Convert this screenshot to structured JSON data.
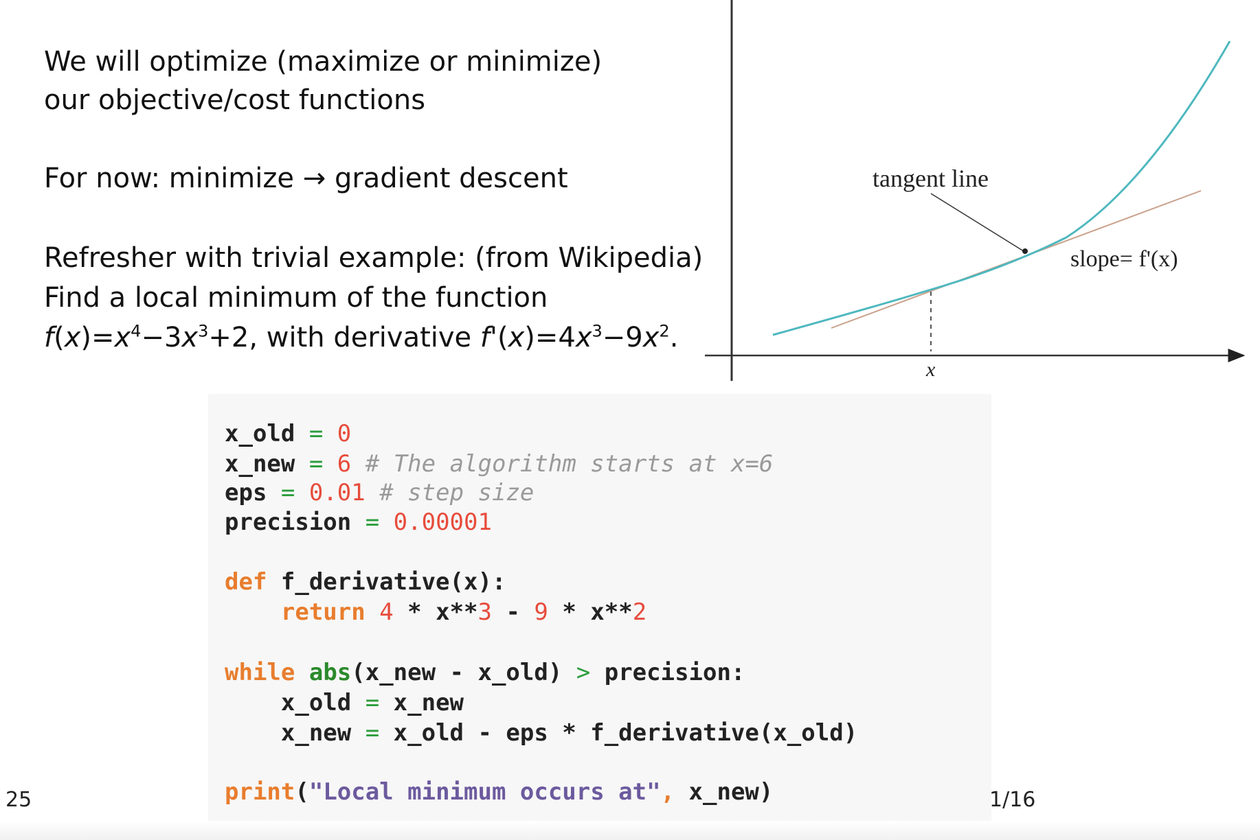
{
  "text": {
    "line1": "We will optimize (maximize or minimize)",
    "line2": "our objective/cost functions",
    "line3": "For now: minimize",
    "arrow": "→",
    "line3_end": "gradient descent",
    "line4": "Refresher with trivial example: (from Wikipedia)",
    "line5": "Find a local minimum of the function",
    "formula": {
      "f": "f",
      "x": "x",
      "eq": ")=",
      "p1": "4",
      "m1": "−3",
      "p2": "3",
      "mid": "+2, with derivative ",
      "fp": "f'",
      "eq2": ")=4",
      "p3": "3",
      "m2": "−9",
      "p4": "2",
      "end": "."
    }
  },
  "figure": {
    "tangent_label": "tangent line",
    "slope_label": "slope= f'(x)",
    "x_label": "x",
    "curve_color": "#4fb8bf",
    "tangent_color": "#c9a08a"
  },
  "code": {
    "l1": [
      "x_old ",
      "=",
      " ",
      "0"
    ],
    "l2": [
      "x_new ",
      "=",
      " ",
      "6",
      " ",
      "# The algorithm starts at x=6"
    ],
    "l3": [
      "eps ",
      "=",
      " ",
      "0.01",
      " ",
      "# step size"
    ],
    "l4": [
      "precision ",
      "=",
      " ",
      "0.00001"
    ],
    "l5": [
      "def",
      " f_derivative(x):"
    ],
    "l6": [
      "    ",
      "return",
      " ",
      "4",
      " * x**",
      "3",
      " - ",
      "9",
      " * x**",
      "2"
    ],
    "l7": [
      "while",
      " ",
      "abs",
      "(x_new - x_old) ",
      ">",
      " precision:"
    ],
    "l8": [
      "    x_old ",
      "=",
      " x_new"
    ],
    "l9": [
      "    x_new ",
      "=",
      " x_old - eps * f_derivative(x_old)"
    ],
    "l10": [
      "print",
      "(",
      "\"Local minimum occurs at\"",
      ",",
      " x_new)"
    ]
  },
  "footer": {
    "page": "25",
    "counter": "1/16"
  }
}
